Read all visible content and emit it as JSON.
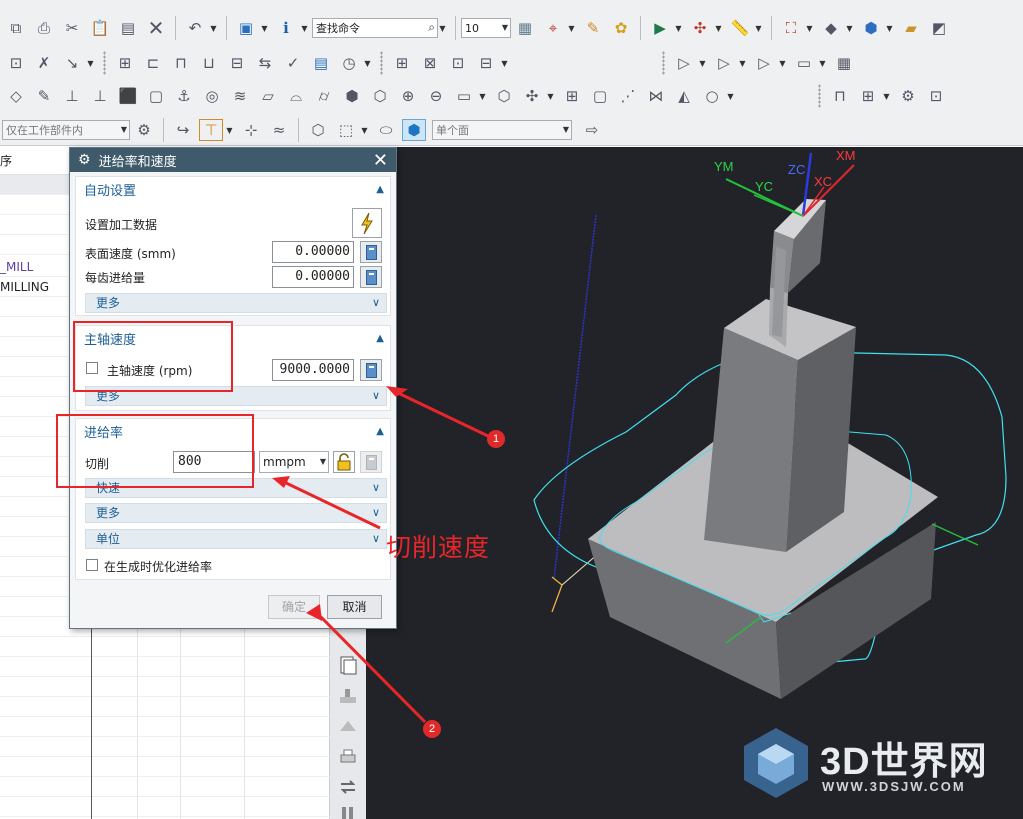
{
  "toolbar": {
    "search_command_placeholder": "查找命令",
    "grid_size_value": "10",
    "selection_scope_value": "仅在工作部件内",
    "face_rule_value": "单个面"
  },
  "navigator": {
    "header_label": "序",
    "rows": [
      {
        "text": "",
        "color": "#222222"
      },
      {
        "text": "",
        "color": "#222222"
      },
      {
        "text": "",
        "color": "#222222"
      },
      {
        "text": "",
        "color": "#5b3fa8"
      },
      {
        "text": "_MILL",
        "color": "#5b3fa8"
      },
      {
        "text": "MILLING",
        "color": "#222222"
      }
    ]
  },
  "dialog": {
    "title": "进给率和速度",
    "auto_settings": {
      "header": "自动设置",
      "set_machining_data_label": "设置加工数据",
      "surface_speed_label": "表面速度 (smm)",
      "surface_speed_value": "0.00000",
      "feed_per_tooth_label": "每齿进给量",
      "feed_per_tooth_value": "0.00000",
      "more_label": "更多"
    },
    "spindle": {
      "header": "主轴速度",
      "spindle_speed_label": "主轴速度 (rpm)",
      "spindle_speed_value": "9000.0000",
      "spindle_checked": false,
      "more_label": "更多"
    },
    "feed_rate": {
      "header": "进给率",
      "cut_label": "切削",
      "cut_value": "800",
      "cut_unit": "mmpm",
      "rapid_label": "快速",
      "more_label": "更多",
      "units_label": "单位",
      "optimize_label": "在生成时优化进给率",
      "optimize_checked": false
    },
    "ok_label": "确定",
    "cancel_label": "取消"
  },
  "annotations": {
    "cut_speed_label": "切削速度",
    "badge_1": "1",
    "badge_2": "2",
    "highlight_color": "#e8262a"
  },
  "viewport": {
    "axes": {
      "zc": "ZC",
      "xc": "XC",
      "yc": "YC",
      "xm": "XM",
      "ym": "YM"
    }
  },
  "watermark": {
    "title": "3D世界网",
    "url": "WWW.3DSJW.COM"
  },
  "colors": {
    "dialog_title_bg": "#3f5a6b",
    "section_header_text": "#1c5f96",
    "viewport_bg": "#222328",
    "toolpath_cyan": "#3fe0f0"
  }
}
